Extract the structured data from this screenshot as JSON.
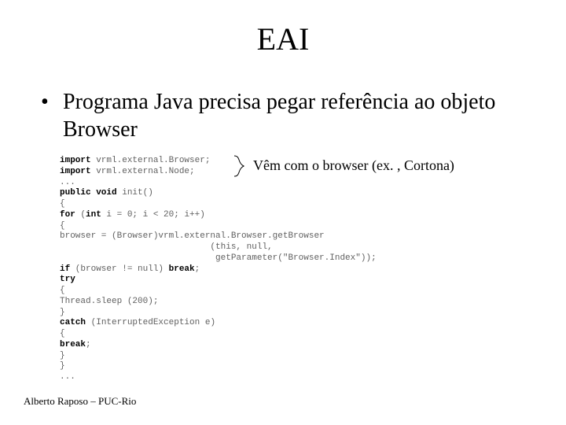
{
  "title": "EAI",
  "bullet": "Programa Java precisa pegar referência ao objeto Browser",
  "annotation": "Vêm com o browser (ex. , Cortona)",
  "footer": "Alberto Raposo – PUC-Rio",
  "code": {
    "l1a": "import",
    "l1b": " vrml.external.Browser;",
    "l2a": "import",
    "l2b": " vrml.external.Node;",
    "l3": "...",
    "l4a": "public void",
    "l4b": " init()",
    "l5": "{",
    "l6a": "for",
    "l6b": " (",
    "l6c": "int",
    "l6d": " i = 0; i < 20; i++)",
    "l7": "{",
    "l8": "browser = (Browser)vrml.external.Browser.getBrowser",
    "l9": "                             (this, null,",
    "l10": "                              getParameter(\"Browser.Index\"));",
    "l11a": "if",
    "l11b": " (browser != null) ",
    "l11c": "break",
    "l11d": ";",
    "l12": "try",
    "l13": "{",
    "l14": "Thread.sleep (200);",
    "l15": "}",
    "l16a": "catch",
    "l16b": " (InterruptedException e)",
    "l17": "{",
    "l18a": "break",
    "l18b": ";",
    "l19": "}",
    "l20": "}",
    "l21": "..."
  }
}
